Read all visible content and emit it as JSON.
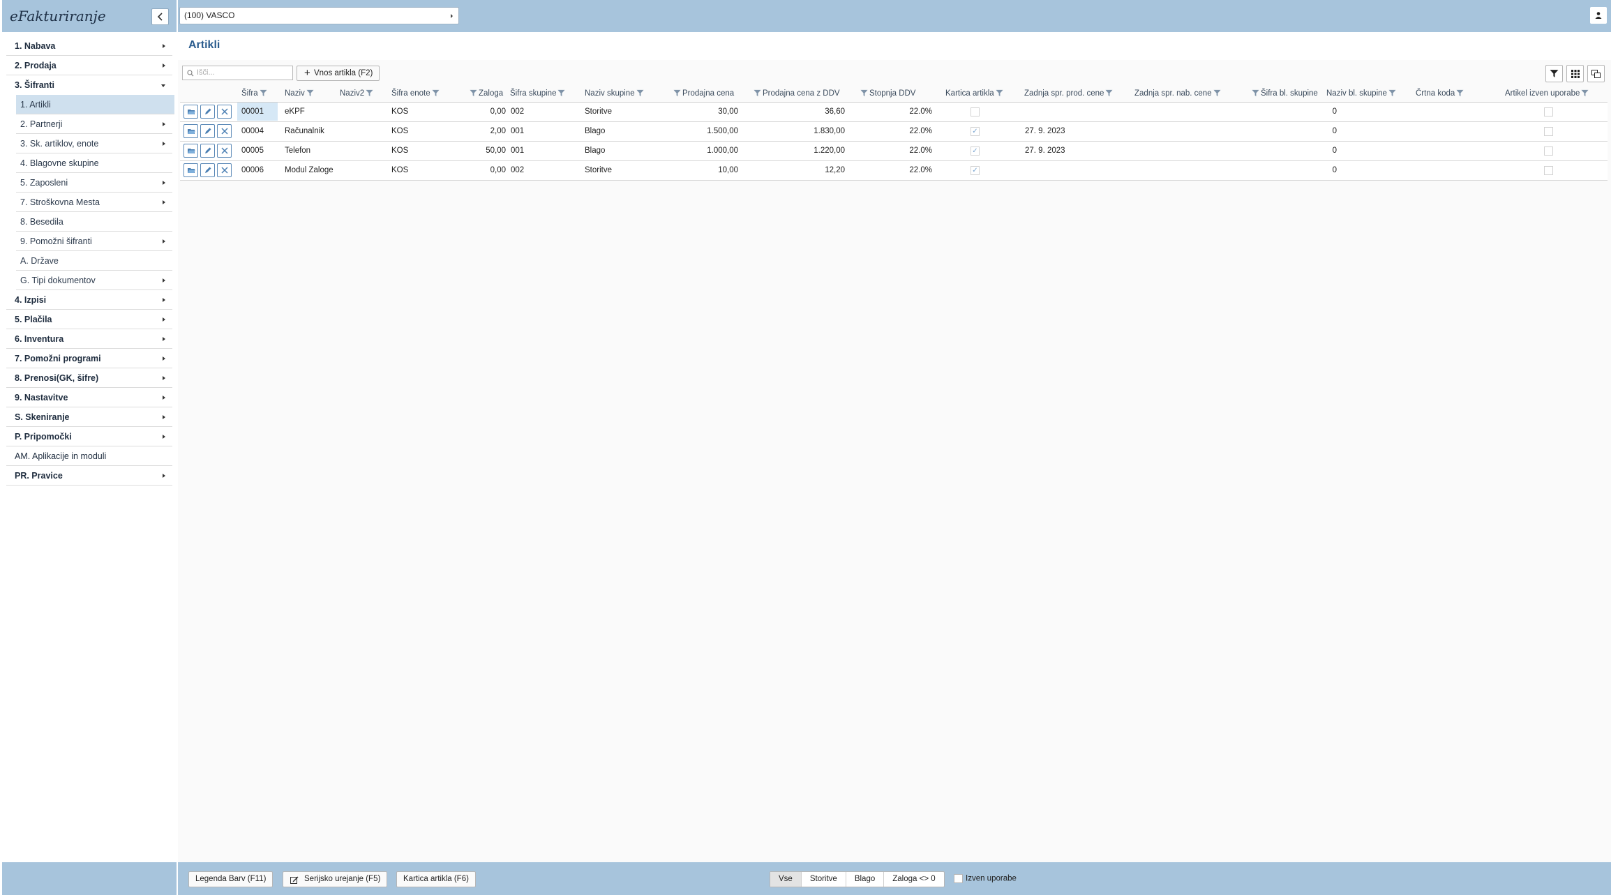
{
  "app": {
    "title": "eFakturiranje"
  },
  "org": {
    "selected": "(100) VASCO"
  },
  "menu": {
    "items": [
      {
        "label": "1. Nabava"
      },
      {
        "label": "2. Prodaja"
      },
      {
        "label": "3. Šifranti"
      },
      {
        "label": "1. Artikli"
      },
      {
        "label": "2. Partnerji"
      },
      {
        "label": "3. Sk. artiklov, enote"
      },
      {
        "label": "4. Blagovne skupine"
      },
      {
        "label": "5. Zaposleni"
      },
      {
        "label": "7. Stroškovna Mesta"
      },
      {
        "label": "8. Besedila"
      },
      {
        "label": "9. Pomožni šifranti"
      },
      {
        "label": "A. Države"
      },
      {
        "label": "G. Tipi dokumentov"
      },
      {
        "label": "4. Izpisi"
      },
      {
        "label": "5. Plačila"
      },
      {
        "label": "6. Inventura"
      },
      {
        "label": "7. Pomožni programi"
      },
      {
        "label": "8. Prenosi(GK, šifre)"
      },
      {
        "label": "9. Nastavitve"
      },
      {
        "label": "S. Skeniranje"
      },
      {
        "label": "P. Pripomočki"
      },
      {
        "label": "AM. Aplikacije in moduli"
      },
      {
        "label": "PR. Pravice"
      }
    ]
  },
  "page": {
    "title": "Artikli"
  },
  "toolbar": {
    "search_placeholder": "Išči...",
    "add_label": "Vnos artikla (F2)"
  },
  "grid": {
    "headers": {
      "sifra": "Šifra",
      "naziv": "Naziv",
      "naziv2": "Naziv2",
      "sifra_enote": "Šifra enote",
      "zaloga": "Zaloga",
      "sifra_skupine": "Šifra skupine",
      "naziv_skupine": "Naziv skupine",
      "prodajna_cena": "Prodajna cena",
      "prodajna_cena_ddv": "Prodajna cena z DDV",
      "stopnja_ddv": "Stopnja DDV",
      "kartica_artikla": "Kartica artikla",
      "zadnja_prod": "Zadnja spr. prod. cene",
      "zadnja_nab": "Zadnja spr. nab. cene",
      "sifra_bl": "Šifra bl. skupine",
      "naziv_bl": "Naziv bl. skupine",
      "crtna_koda": "Črtna koda",
      "izven_uporabe": "Artikel izven uporabe"
    },
    "rows": [
      {
        "sifra": "00001",
        "naziv": "eKPF",
        "enota": "KOS",
        "zaloga": "0,00",
        "skupina": "002",
        "naziv_skupine": "Storitve",
        "cena": "30,00",
        "cena_ddv": "36,60",
        "ddv": "22.0%",
        "kartica": false,
        "zadnja_prod": "",
        "sifra_bl": "0",
        "izven": false
      },
      {
        "sifra": "00004",
        "naziv": "Računalnik",
        "enota": "KOS",
        "zaloga": "2,00",
        "skupina": "001",
        "naziv_skupine": "Blago",
        "cena": "1.500,00",
        "cena_ddv": "1.830,00",
        "ddv": "22.0%",
        "kartica": true,
        "zadnja_prod": "27. 9. 2023",
        "sifra_bl": "0",
        "izven": false
      },
      {
        "sifra": "00005",
        "naziv": "Telefon",
        "enota": "KOS",
        "zaloga": "50,00",
        "skupina": "001",
        "naziv_skupine": "Blago",
        "cena": "1.000,00",
        "cena_ddv": "1.220,00",
        "ddv": "22.0%",
        "kartica": true,
        "zadnja_prod": "27. 9. 2023",
        "sifra_bl": "0",
        "izven": false
      },
      {
        "sifra": "00006",
        "naziv": "Modul Zaloge",
        "enota": "KOS",
        "zaloga": "0,00",
        "skupina": "002",
        "naziv_skupine": "Storitve",
        "cena": "10,00",
        "cena_ddv": "12,20",
        "ddv": "22.0%",
        "kartica": true,
        "zadnja_prod": "",
        "sifra_bl": "0",
        "izven": false
      }
    ]
  },
  "bottom": {
    "legend": "Legenda Barv (F11)",
    "serial": "Serijsko urejanje (F5)",
    "card": "Kartica artikla (F6)",
    "filters": [
      "Vse",
      "Storitve",
      "Blago",
      "Zaloga <> 0"
    ],
    "izven_label": "Izven uporabe"
  },
  "colors": {
    "header_bar": "#a7c4dc",
    "accent": "#2b5c8e",
    "selected": "#cfe0ee"
  }
}
